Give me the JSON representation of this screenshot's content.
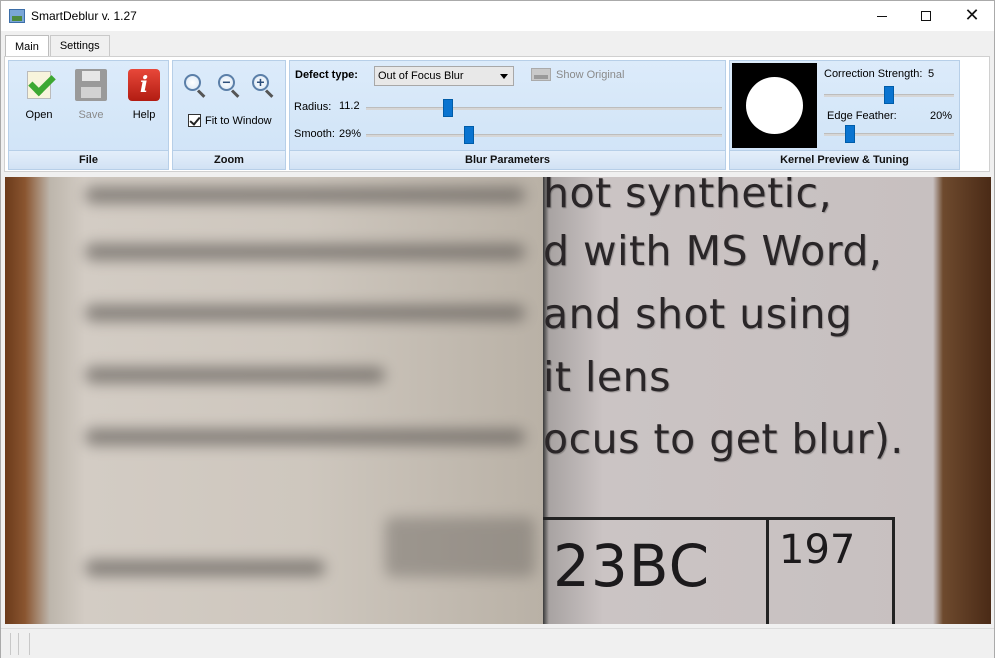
{
  "window": {
    "title": "SmartDeblur v. 1.27"
  },
  "tabs": [
    {
      "label": "Main",
      "active": true
    },
    {
      "label": "Settings",
      "active": false
    }
  ],
  "file_group": {
    "title": "File",
    "open_label": "Open",
    "save_label": "Save",
    "help_label": "Help"
  },
  "zoom_group": {
    "title": "Zoom",
    "fit_to_window_label": "Fit to Window",
    "fit_to_window_checked": true
  },
  "blur_group": {
    "title": "Blur Parameters",
    "defect_type_label": "Defect type:",
    "defect_type_value": "Out of Focus Blur",
    "show_original_label": "Show Original",
    "radius_label": "Radius:",
    "radius_value": "11.2",
    "radius_fraction": 0.23,
    "smooth_label": "Smooth:",
    "smooth_value": "29%",
    "smooth_fraction": 0.29
  },
  "kernel_group": {
    "title": "Kernel Preview & Tuning",
    "strength_label": "Correction Strength:",
    "strength_value": "5",
    "strength_fraction": 0.5,
    "feather_label": "Edge Feather:",
    "feather_value": "20%",
    "feather_fraction": 0.2
  },
  "image": {
    "lines": [
      "hot synthetic,",
      "d with MS Word,",
      "and shot using",
      "it lens",
      "ocus to get blur)."
    ],
    "code_big": "23BC",
    "code_small": "197"
  },
  "colors": {
    "accent": "#0a74d0",
    "ribbon_group": "#dcebfa"
  }
}
